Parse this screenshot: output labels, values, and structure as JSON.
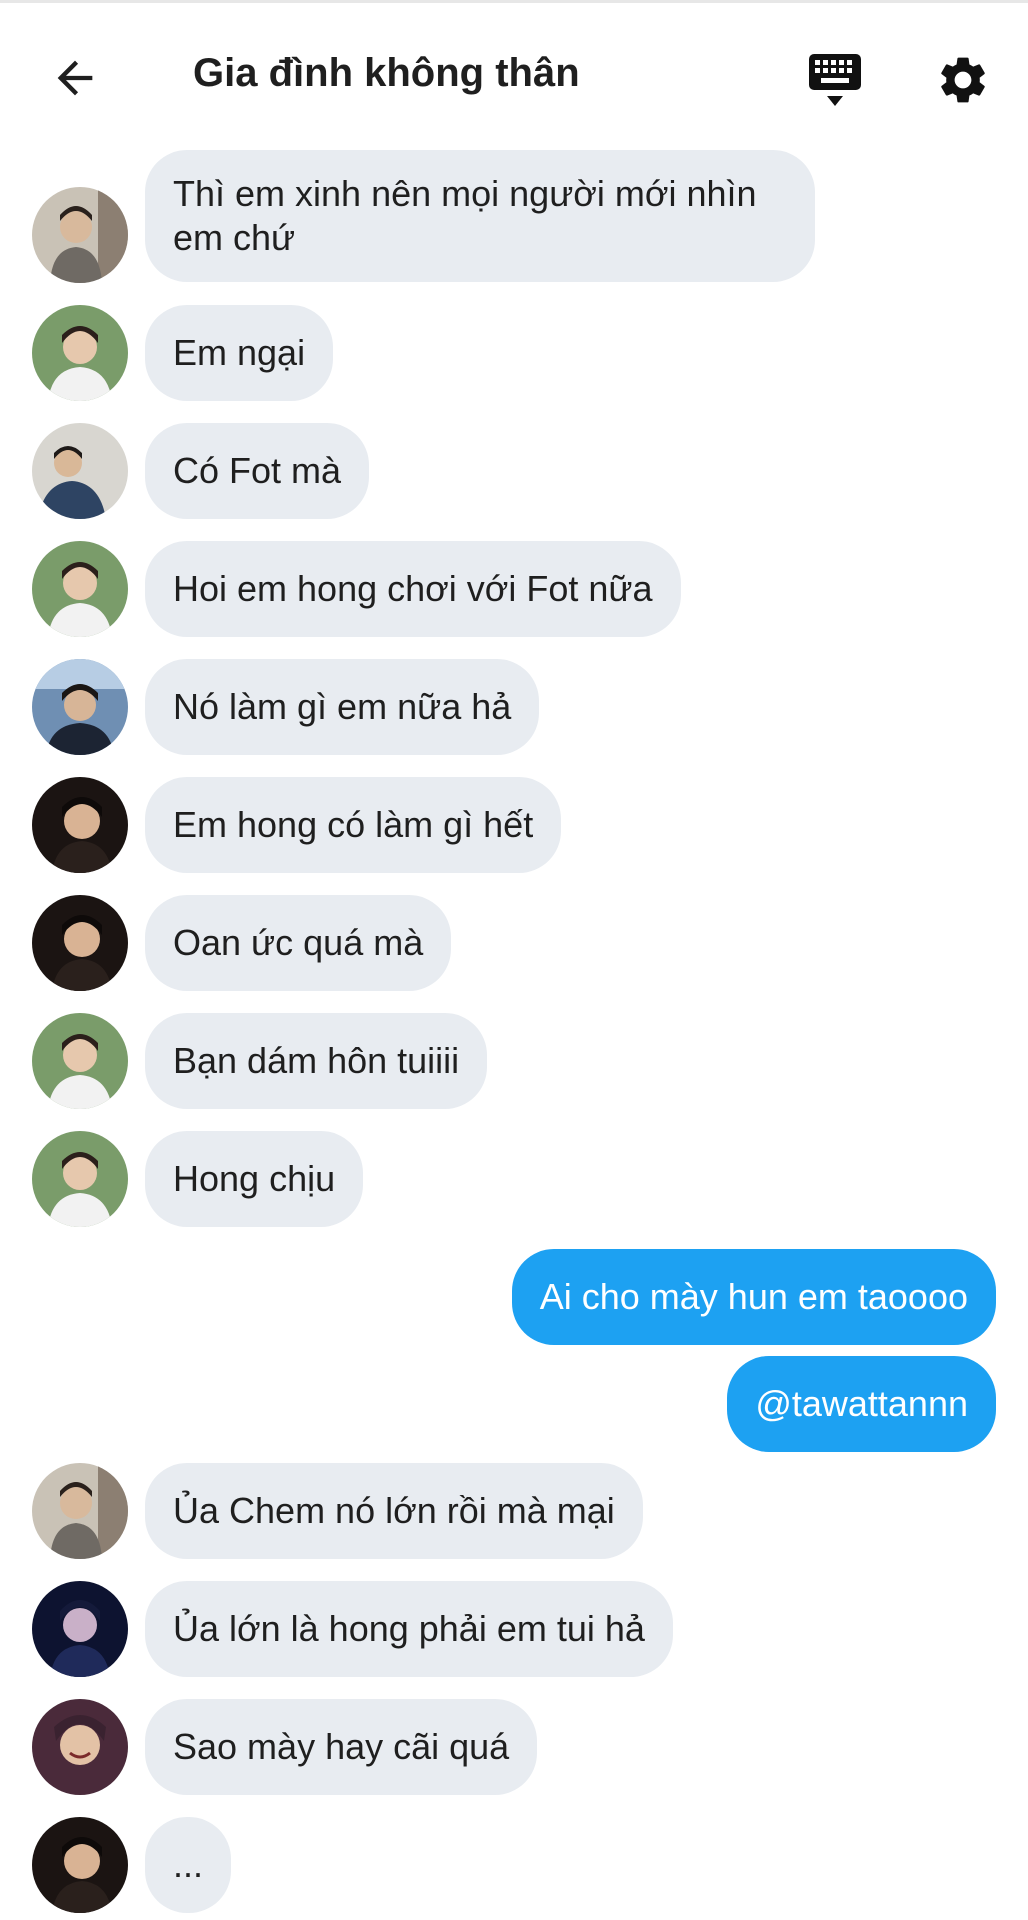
{
  "header": {
    "title": "Gia đình không thân",
    "back_icon": "arrow-left-icon",
    "keyboard_icon": "keyboard-icon",
    "settings_icon": "gear-icon"
  },
  "colors": {
    "incoming_bubble": "#e8ecf1",
    "outgoing_bubble": "#1da1f2",
    "text": "#1f1f1f"
  },
  "messages": [
    {
      "direction": "incoming",
      "text": "Thì em xinh nên mọi người mới nhìn em chứ"
    },
    {
      "direction": "incoming",
      "text": "Em ngại"
    },
    {
      "direction": "incoming",
      "text": "Có Fot mà"
    },
    {
      "direction": "incoming",
      "text": "Hoi em hong chơi với Fot nữa"
    },
    {
      "direction": "incoming",
      "text": "Nó làm gì em nữa hả"
    },
    {
      "direction": "incoming",
      "text": "Em hong có làm gì hết"
    },
    {
      "direction": "incoming",
      "text": "Oan ức quá mà"
    },
    {
      "direction": "incoming",
      "text": "Bạn dám hôn tuiiii"
    },
    {
      "direction": "incoming",
      "text": "Hong chịu"
    },
    {
      "direction": "outgoing",
      "text": "Ai cho mày hun em taoooo"
    },
    {
      "direction": "outgoing",
      "text": "@tawattannn"
    },
    {
      "direction": "incoming",
      "text": "Ủa Chem nó lớn rồi mà mại"
    },
    {
      "direction": "incoming",
      "text": "Ủa lớn là hong phải em tui hả"
    },
    {
      "direction": "incoming",
      "text": "Sao mày hay cãi quá"
    },
    {
      "direction": "incoming",
      "text": "..."
    }
  ]
}
